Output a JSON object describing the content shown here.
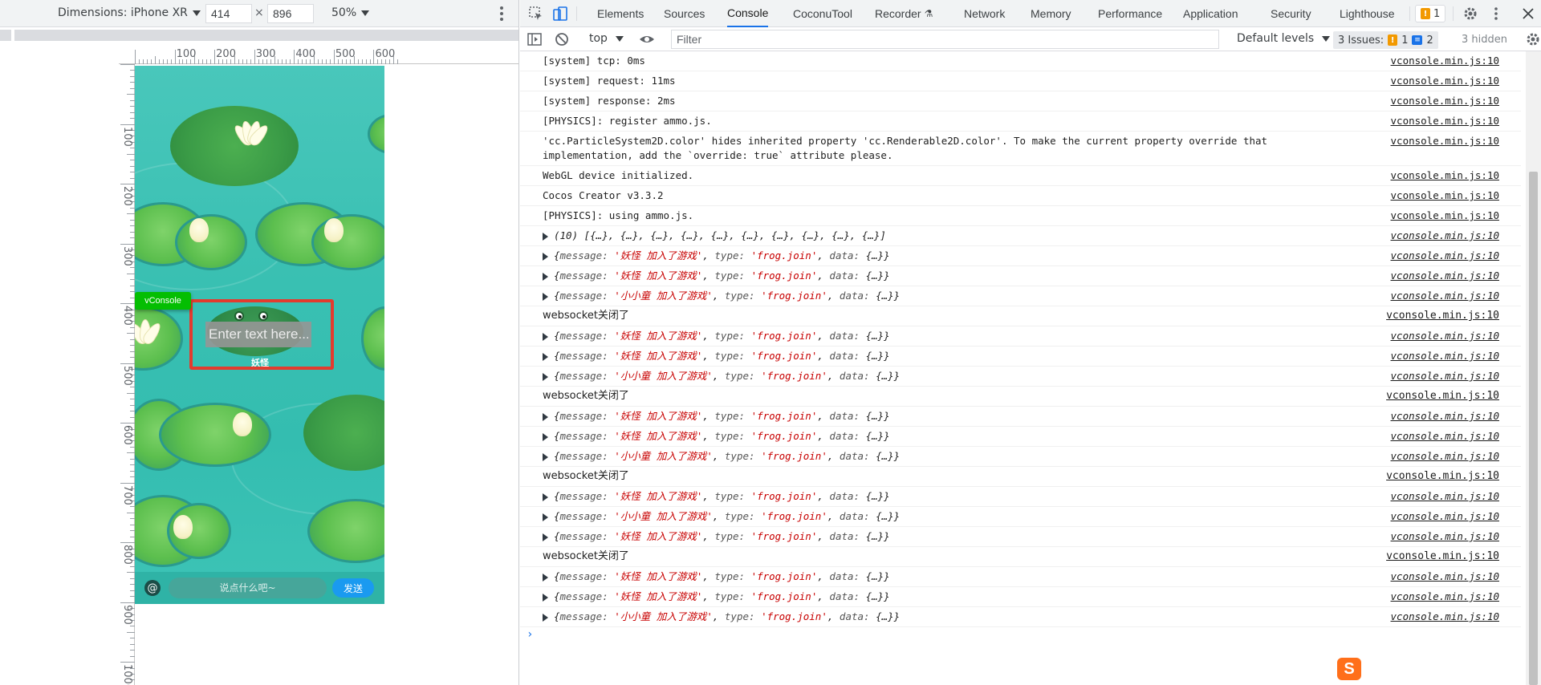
{
  "device_toolbar": {
    "dimensions_label": "Dimensions: iPhone XR",
    "width_value": "414",
    "height_value": "896",
    "times": "×",
    "zoom_label": "50%"
  },
  "rulers": {
    "top_ticks": [
      "100",
      "200",
      "300",
      "400",
      "500",
      "600"
    ],
    "left_ticks": [
      "100",
      "200",
      "300",
      "400",
      "500",
      "600",
      "700",
      "800",
      "900",
      "1000"
    ]
  },
  "game": {
    "vconsole_label": "vConsole",
    "text_placeholder": "Enter text here...",
    "frog_name": "妖怪",
    "at_symbol": "@",
    "chat_placeholder": "说点什么吧~",
    "send_label": "发送"
  },
  "devtools": {
    "tabs": [
      "Elements",
      "Sources",
      "Console",
      "CoconuTool",
      "Recorder",
      "Network",
      "Memory",
      "Performance",
      "Application",
      "Security",
      "Lighthouse"
    ],
    "active_tab": "Console",
    "issues_badge": "1",
    "context": "top",
    "filter_placeholder": "Filter",
    "levels_label": "Default levels",
    "issues_label": "3 Issues:",
    "issues_warn": "1",
    "issues_info": "2",
    "hidden_label": "3 hidden",
    "prompt_symbol": "›"
  },
  "console_rows": [
    {
      "kind": "plain",
      "text": "[system] tcp: 0ms",
      "src": "vconsole.min.js:10"
    },
    {
      "kind": "plain",
      "text": "[system] request: 11ms",
      "src": "vconsole.min.js:10"
    },
    {
      "kind": "plain",
      "text": "[system] response: 2ms",
      "src": "vconsole.min.js:10"
    },
    {
      "kind": "plain",
      "text": "[PHYSICS]: register ammo.js.",
      "src": "vconsole.min.js:10"
    },
    {
      "kind": "wrap",
      "text": "'cc.ParticleSystem2D.color' hides inherited property 'cc.Renderable2D.color'. To make the current property override that implementation, add the `override: true` attribute please.",
      "src": "vconsole.min.js:10"
    },
    {
      "kind": "plain",
      "text": "WebGL device initialized.",
      "src": "vconsole.min.js:10"
    },
    {
      "kind": "plain",
      "text": "Cocos Creator v3.3.2",
      "src": "vconsole.min.js:10"
    },
    {
      "kind": "plain",
      "text": "[PHYSICS]: using ammo.js.",
      "src": "vconsole.min.js:10"
    },
    {
      "kind": "array",
      "text": "(10) [{…}, {…}, {…}, {…}, {…}, {…}, {…}, {…}, {…}, {…}]",
      "src": "vconsole.min.js:10"
    },
    {
      "kind": "obj",
      "msg": "'妖怪 加入了游戏'",
      "type": "'frog.join'",
      "src": "vconsole.min.js:10"
    },
    {
      "kind": "obj",
      "msg": "'妖怪 加入了游戏'",
      "type": "'frog.join'",
      "src": "vconsole.min.js:10"
    },
    {
      "kind": "obj",
      "msg": "'小小童 加入了游戏'",
      "type": "'frog.join'",
      "src": "vconsole.min.js:10"
    },
    {
      "kind": "cn",
      "text": "websocket关闭了",
      "src": "vconsole.min.js:10"
    },
    {
      "kind": "obj",
      "msg": "'妖怪 加入了游戏'",
      "type": "'frog.join'",
      "src": "vconsole.min.js:10"
    },
    {
      "kind": "obj",
      "msg": "'妖怪 加入了游戏'",
      "type": "'frog.join'",
      "src": "vconsole.min.js:10"
    },
    {
      "kind": "obj",
      "msg": "'小小童 加入了游戏'",
      "type": "'frog.join'",
      "src": "vconsole.min.js:10"
    },
    {
      "kind": "cn",
      "text": "websocket关闭了",
      "src": "vconsole.min.js:10"
    },
    {
      "kind": "obj",
      "msg": "'妖怪 加入了游戏'",
      "type": "'frog.join'",
      "src": "vconsole.min.js:10"
    },
    {
      "kind": "obj",
      "msg": "'妖怪 加入了游戏'",
      "type": "'frog.join'",
      "src": "vconsole.min.js:10"
    },
    {
      "kind": "obj",
      "msg": "'小小童 加入了游戏'",
      "type": "'frog.join'",
      "src": "vconsole.min.js:10"
    },
    {
      "kind": "cn",
      "text": "websocket关闭了",
      "src": "vconsole.min.js:10"
    },
    {
      "kind": "obj",
      "msg": "'妖怪 加入了游戏'",
      "type": "'frog.join'",
      "src": "vconsole.min.js:10"
    },
    {
      "kind": "obj",
      "msg": "'小小童 加入了游戏'",
      "type": "'frog.join'",
      "src": "vconsole.min.js:10"
    },
    {
      "kind": "obj",
      "msg": "'妖怪 加入了游戏'",
      "type": "'frog.join'",
      "src": "vconsole.min.js:10"
    },
    {
      "kind": "cn",
      "text": "websocket关闭了",
      "src": "vconsole.min.js:10"
    },
    {
      "kind": "obj",
      "msg": "'妖怪 加入了游戏'",
      "type": "'frog.join'",
      "src": "vconsole.min.js:10"
    },
    {
      "kind": "obj",
      "msg": "'妖怪 加入了游戏'",
      "type": "'frog.join'",
      "src": "vconsole.min.js:10"
    },
    {
      "kind": "obj",
      "msg": "'小小童 加入了游戏'",
      "type": "'frog.join'",
      "src": "vconsole.min.js:10"
    }
  ],
  "colors": {
    "accent": "#1a73e8",
    "vconsole_green": "#04be02",
    "highlight_red": "#e33b2e",
    "string_red": "#c80000",
    "send_blue": "#1a9af0"
  }
}
